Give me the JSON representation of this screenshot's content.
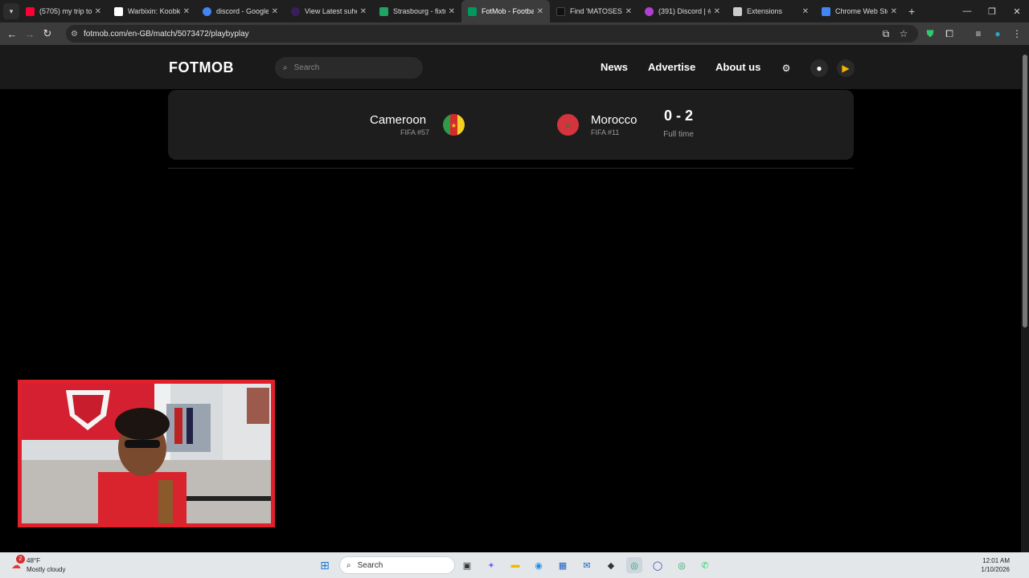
{
  "browser": {
    "tabs": [
      {
        "title": "(5705) my trip to",
        "color": "#ff0033"
      },
      {
        "title": "Warbixin: Koobka",
        "color": "#ffffff"
      },
      {
        "title": "discord - Google",
        "color": "#4285f4"
      },
      {
        "title": "View Latest suhey",
        "color": "#3a1d5c"
      },
      {
        "title": "Strasbourg - fixtu",
        "color": "#1fa463"
      },
      {
        "title": "FotMob - Footbal",
        "color": "#00985f"
      },
      {
        "title": "Find 'MATOSESID'",
        "color": "#111111"
      },
      {
        "title": "(391) Discord | #",
        "color": "#b040d0"
      },
      {
        "title": "Extensions",
        "color": "#cccccc"
      },
      {
        "title": "Chrome Web Stor",
        "color": "#4285f4"
      }
    ],
    "url": "fotmob.com/en-GB/match/5073472/playbyplay"
  },
  "site": {
    "logo": "FOTMOB",
    "search_placeholder": "Search",
    "nav": {
      "news": "News",
      "advertise": "Advertise",
      "about": "About us"
    }
  },
  "match": {
    "home": {
      "name": "Cameroon",
      "rank": "FIFA #57"
    },
    "away": {
      "name": "Morocco",
      "rank": "FIFA #11"
    },
    "score": "0 - 2",
    "status": "Full time"
  },
  "taskbar": {
    "weather_temp": "48°F",
    "weather_desc": "Mostly cloudy",
    "weather_badge": "2",
    "search_label": "Search",
    "time": "12:01 AM",
    "date": "1/10/2026"
  }
}
